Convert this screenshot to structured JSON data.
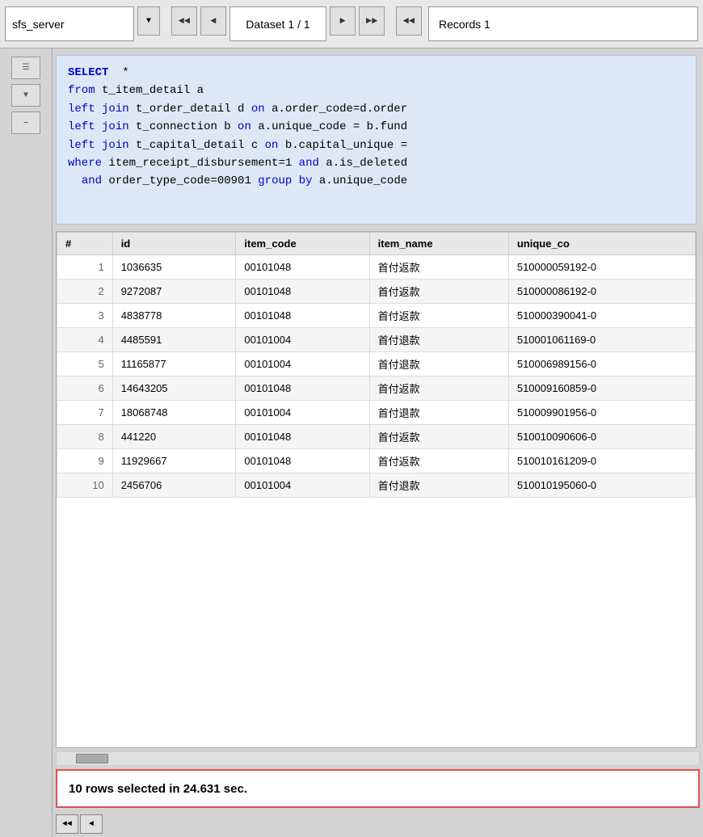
{
  "toolbar": {
    "server_name": "sfs_server",
    "dataset_label": "Dataset 1 / 1",
    "records_label": "Records 1"
  },
  "query": {
    "line1": "SELECT  *",
    "line2": "from t_item_detail a",
    "line3": "left join t_order_detail d on a.order_code=d.order",
    "line4": "left join t_connection b on a.unique_code = b.fund",
    "line5": "left join t_capital_detail c on b.capital_unique =",
    "line6": "where item_receipt_disbursement=1 and a.is_deleted",
    "line7": "  and order_type_code=00901 group by a.unique_code"
  },
  "table": {
    "columns": [
      "#",
      "id",
      "item_code",
      "item_name",
      "unique_co"
    ],
    "rows": [
      {
        "num": "1",
        "id": "1036635",
        "item_code": "00101048",
        "item_name": "首付返款",
        "unique_co": "510000059192-0"
      },
      {
        "num": "2",
        "id": "9272087",
        "item_code": "00101048",
        "item_name": "首付返款",
        "unique_co": "510000086192-0"
      },
      {
        "num": "3",
        "id": "4838778",
        "item_code": "00101048",
        "item_name": "首付返款",
        "unique_co": "510000390041-0"
      },
      {
        "num": "4",
        "id": "4485591",
        "item_code": "00101004",
        "item_name": "首付退款",
        "unique_co": "510001061169-0"
      },
      {
        "num": "5",
        "id": "11165877",
        "item_code": "00101004",
        "item_name": "首付退款",
        "unique_co": "510006989156-0"
      },
      {
        "num": "6",
        "id": "14643205",
        "item_code": "00101048",
        "item_name": "首付返款",
        "unique_co": "510009160859-0"
      },
      {
        "num": "7",
        "id": "18068748",
        "item_code": "00101004",
        "item_name": "首付退款",
        "unique_co": "510009901956-0"
      },
      {
        "num": "8",
        "id": "441220",
        "item_code": "00101048",
        "item_name": "首付返款",
        "unique_co": "510010090606-0"
      },
      {
        "num": "9",
        "id": "11929667",
        "item_code": "00101048",
        "item_name": "首付返款",
        "unique_co": "510010161209-0"
      },
      {
        "num": "10",
        "id": "2456706",
        "item_code": "00101004",
        "item_name": "首付退款",
        "unique_co": "510010195060-0"
      }
    ]
  },
  "status": {
    "message": "10 rows selected in 24.631 sec."
  },
  "sidebar": {
    "btn1_label": "≡",
    "btn2_label": "▼",
    "btn3_label": "—"
  }
}
